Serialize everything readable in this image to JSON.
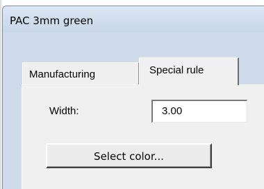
{
  "window": {
    "title": "PAC 3mm green"
  },
  "tabs": [
    {
      "label": "Manufacturing",
      "selected": false
    },
    {
      "label": "Special rule",
      "selected": true
    }
  ],
  "form": {
    "width_label": "Width:",
    "width_value": "3.00",
    "select_color_label": "Select color..."
  },
  "colors": {
    "titlebar": "#cfdcec",
    "client_background": "#f0f0f0",
    "input_background": "#ffffff"
  }
}
